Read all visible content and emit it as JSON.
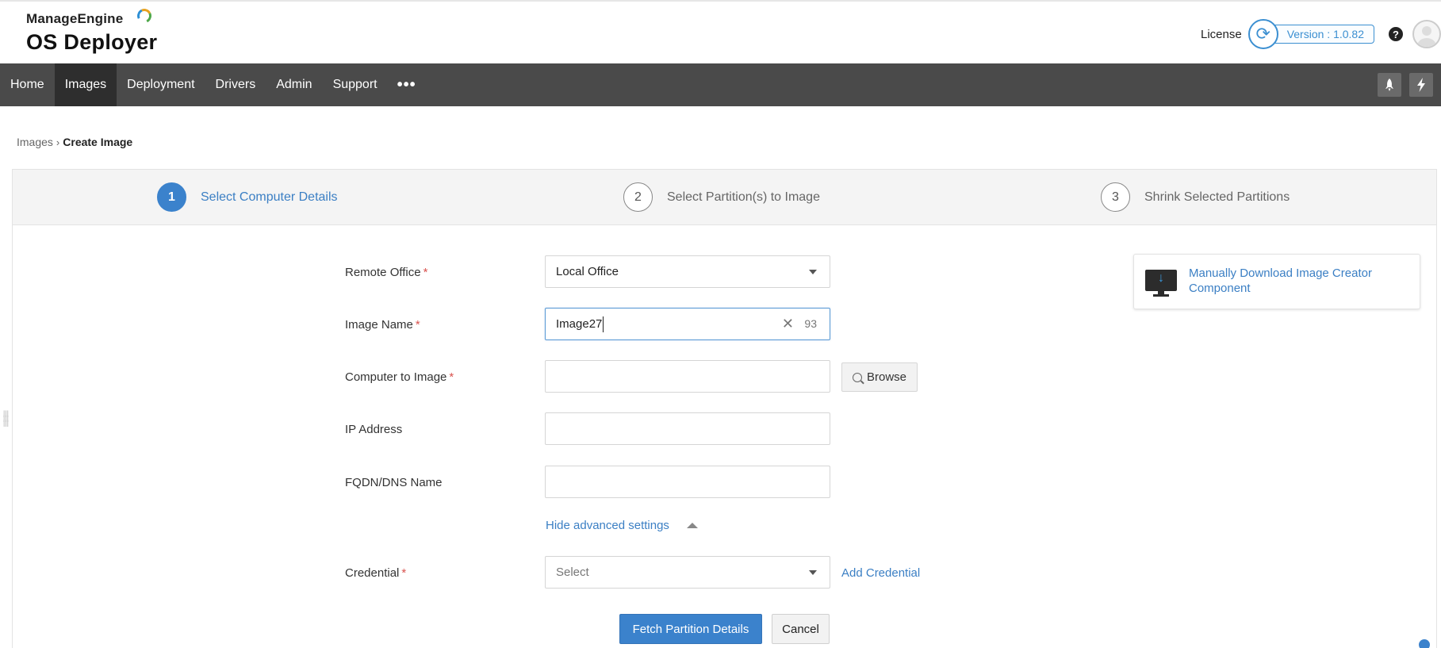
{
  "brand": {
    "company": "ManageEngine",
    "product": "OS Deployer"
  },
  "header": {
    "license_label": "License",
    "version_label": "Version : 1.0.82",
    "help_symbol": "?"
  },
  "nav": {
    "items": [
      {
        "label": "Home",
        "active": false
      },
      {
        "label": "Images",
        "active": true
      },
      {
        "label": "Deployment",
        "active": false
      },
      {
        "label": "Drivers",
        "active": false
      },
      {
        "label": "Admin",
        "active": false
      },
      {
        "label": "Support",
        "active": false
      }
    ],
    "more_label": "•••",
    "right_icons": [
      "rocket-icon",
      "lightning-icon"
    ]
  },
  "breadcrumb": {
    "parent": "Images",
    "current": "Create Image"
  },
  "steps": [
    {
      "number": "1",
      "label": "Select Computer Details",
      "active": true
    },
    {
      "number": "2",
      "label": "Select Partition(s) to Image",
      "active": false
    },
    {
      "number": "3",
      "label": "Shrink Selected Partitions",
      "active": false
    }
  ],
  "form": {
    "remote_office": {
      "label": "Remote Office",
      "value": "Local Office",
      "required": true
    },
    "image_name": {
      "label": "Image Name",
      "value": "Image27",
      "remaining_chars": "93",
      "required": true
    },
    "computer": {
      "label": "Computer to Image",
      "value": "",
      "required": true,
      "browse_label": "Browse"
    },
    "ip_address": {
      "label": "IP Address",
      "value": ""
    },
    "fqdn": {
      "label": "FQDN/DNS Name",
      "value": ""
    },
    "advanced_toggle": "Hide advanced settings",
    "credential": {
      "label": "Credential",
      "placeholder": "Select",
      "required": true,
      "add_label": "Add Credential"
    },
    "required_marker": "*"
  },
  "actions": {
    "primary": "Fetch Partition Details",
    "cancel": "Cancel"
  },
  "download_card": {
    "text": "Manually Download Image Creator Component",
    "icon": "monitor-download-icon"
  },
  "colors": {
    "accent": "#3b82cc",
    "nav_bg": "#4a4a4a",
    "nav_active": "#2e2e2e",
    "link": "#3b7fc4",
    "required": "#d9534f"
  }
}
